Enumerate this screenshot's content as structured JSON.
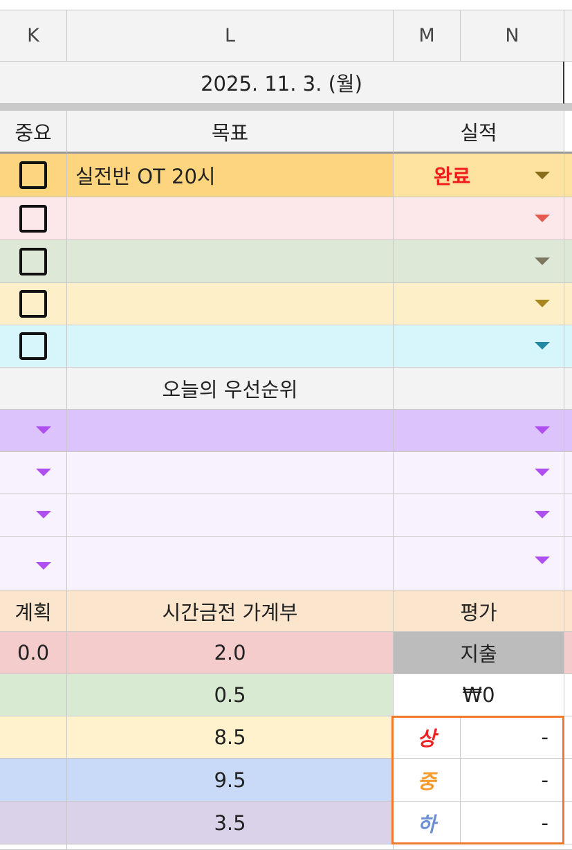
{
  "columns": [
    "K",
    "L",
    "M",
    "N"
  ],
  "date": "2025. 11. 3. (월)",
  "headers": {
    "importance": "중요",
    "goal": "목표",
    "result": "실적"
  },
  "goals": [
    {
      "text": "실전반 OT 20시",
      "status": "완료",
      "bg": "#fdd57e",
      "status_bg": "#fde39f",
      "arrow": "#8a6d1a"
    },
    {
      "text": "",
      "status": "",
      "bg": "#fce8ea",
      "status_bg": "#fce8ea",
      "arrow": "#e55a4f"
    },
    {
      "text": "",
      "status": "",
      "bg": "#dde9d6",
      "status_bg": "#dde9d6",
      "arrow": "#7d7660"
    },
    {
      "text": "",
      "status": "",
      "bg": "#fdf0c9",
      "status_bg": "#fdf0c9",
      "arrow": "#a8861f"
    },
    {
      "text": "",
      "status": "",
      "bg": "#d7f6fb",
      "status_bg": "#d7f6fb",
      "arrow": "#2389a2"
    }
  ],
  "priority_header": "오늘의 우선순위",
  "priorities": [
    {
      "bg": "#dcc3fb"
    },
    {
      "bg": "#f8f1fe"
    },
    {
      "bg": "#f8f1fe"
    },
    {
      "bg": "#f8f1fe"
    }
  ],
  "ledger_headers": {
    "plan": "계획",
    "ledger": "시간금전 가계부",
    "eval": "평가"
  },
  "ledger_rows": [
    {
      "plan": "0.0",
      "value": "2.0",
      "bg": "#f4cccc"
    },
    {
      "plan": "",
      "value": "0.5",
      "bg": "#d9ead3"
    },
    {
      "plan": "",
      "value": "8.5",
      "bg": "#fff2cc"
    },
    {
      "plan": "",
      "value": "9.5",
      "bg": "#c9daf8"
    },
    {
      "plan": "",
      "value": "3.5",
      "bg": "#d9d2e9"
    }
  ],
  "expense_label": "지출",
  "expense_value": "₩0",
  "grades": [
    {
      "label": "상",
      "value": "-",
      "color": "#ee2222"
    },
    {
      "label": "중",
      "value": "-",
      "color": "#f59a2a"
    },
    {
      "label": "하",
      "value": "-",
      "color": "#6d8fd6"
    }
  ],
  "colors": {
    "arrow_purple": "#b04ff0",
    "expense_bg": "#bcbcbc",
    "ledger_header_bg": "#fce5cd",
    "accent_orange": "#f07a2c"
  }
}
